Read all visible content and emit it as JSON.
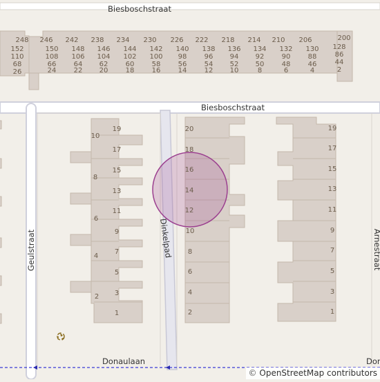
{
  "map": {
    "streets": {
      "top": "Biesboschstraat",
      "middle": "Biesboschstraat",
      "left": "Geulstraat",
      "center": "Dinkelpad",
      "right": "Arnestraat",
      "bottom": "Donaulaan",
      "bottom_right": "Don"
    },
    "house_numbers": {
      "top_row_a": [
        "248",
        "246",
        "242",
        "238",
        "234",
        "230",
        "226",
        "222",
        "218",
        "214",
        "210",
        "206",
        "200"
      ],
      "top_row_b": [
        "152",
        "150",
        "148",
        "146",
        "144",
        "142",
        "140",
        "138",
        "136",
        "134",
        "132",
        "130",
        "128"
      ],
      "top_row_c": [
        "110",
        "108",
        "106",
        "104",
        "102",
        "100",
        "98",
        "96",
        "94",
        "92",
        "90",
        "88",
        "86"
      ],
      "top_row_d": [
        "68",
        "66",
        "64",
        "62",
        "60",
        "58",
        "56",
        "54",
        "52",
        "50",
        "48",
        "46",
        "44"
      ],
      "top_row_e": [
        "26",
        "24",
        "22",
        "20",
        "18",
        "16",
        "14",
        "12",
        "10",
        "8",
        "6",
        "4",
        "2"
      ],
      "left_block_outer": [
        "10",
        "8",
        "6",
        "4",
        "2"
      ],
      "left_block_inner": [
        "19",
        "17",
        "15",
        "13",
        "11",
        "9",
        "7",
        "5",
        "3",
        "1"
      ],
      "middle_block": [
        "20",
        "18",
        "16",
        "14",
        "12",
        "10",
        "8",
        "6",
        "4",
        "2"
      ],
      "right_block": [
        "19",
        "17",
        "15",
        "13",
        "11",
        "9",
        "7",
        "5",
        "3",
        "1"
      ]
    },
    "highlight_color": "#9b3f8f",
    "recycling_icon": "recycling-icon",
    "attribution": {
      "copyright": "©",
      "text": "OpenStreetMap contributors"
    }
  }
}
